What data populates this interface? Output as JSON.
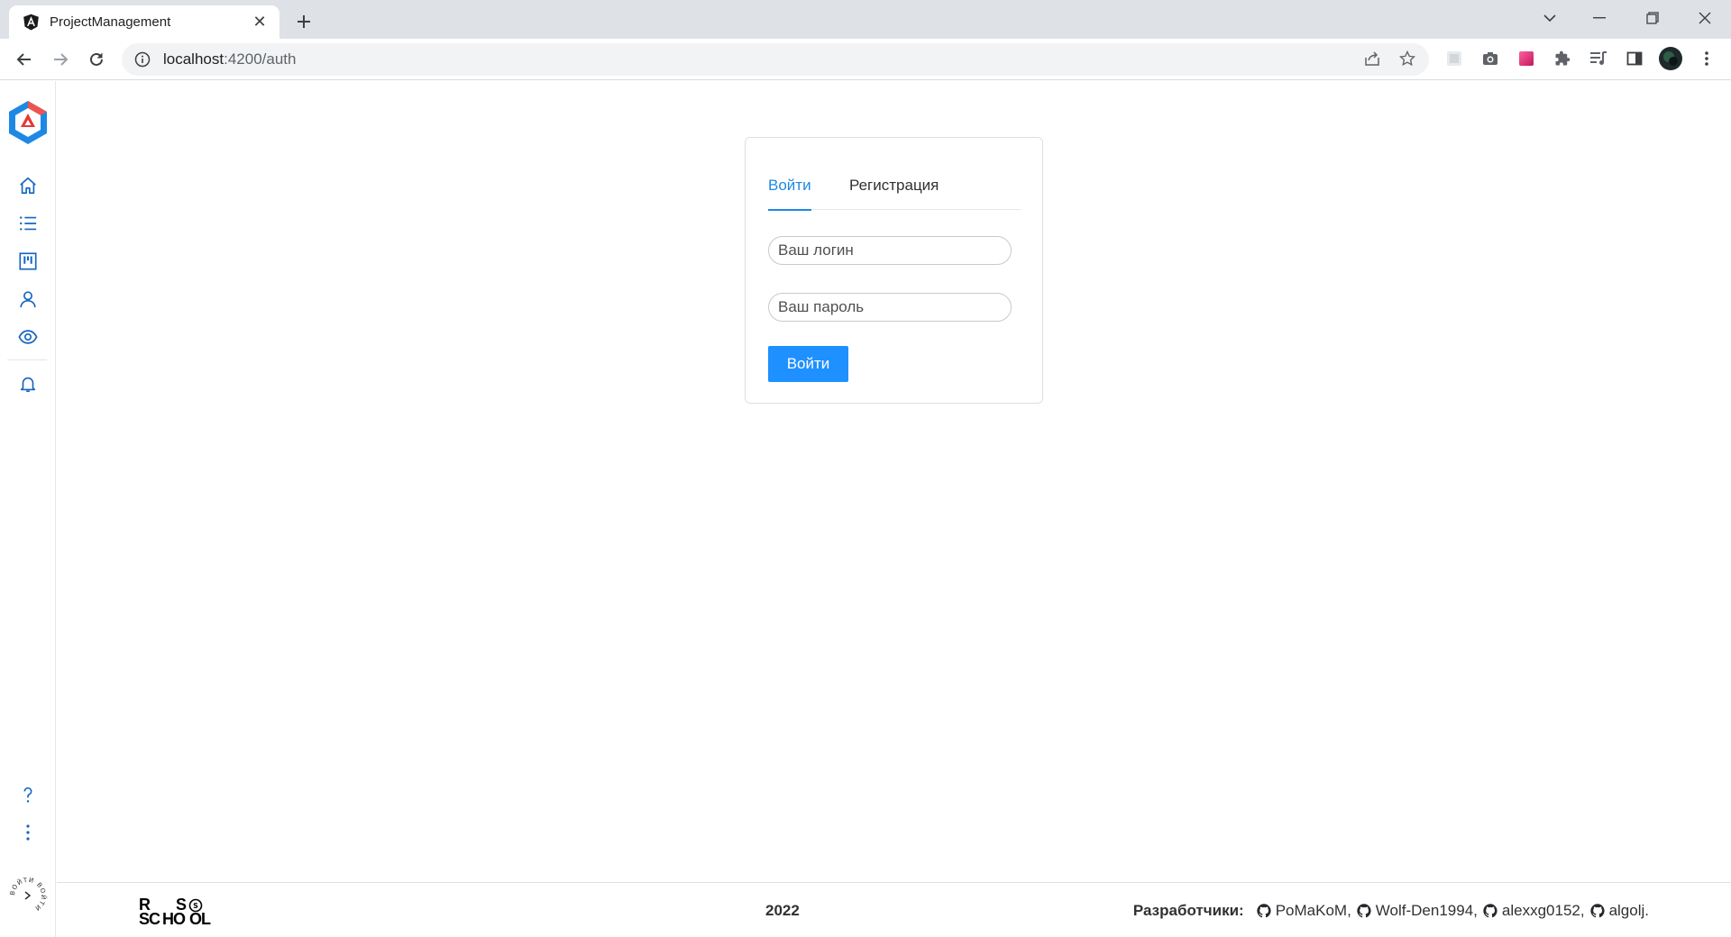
{
  "browser": {
    "tab_title": "ProjectManagement",
    "tab_close": "✕",
    "url_host": "localhost",
    "url_rest": ":4200/auth"
  },
  "sidebar": {
    "items": [
      "home-icon",
      "list-icon",
      "board-icon",
      "user-icon",
      "eye-icon",
      "bell-icon"
    ],
    "bottom_items": [
      "help-icon",
      "more-icon"
    ],
    "badge_text": "ВОЙТИ ВОЙТИ"
  },
  "auth": {
    "tabs": [
      {
        "label": "Войти",
        "active": true
      },
      {
        "label": "Регистрация",
        "active": false
      }
    ],
    "login_placeholder": "Ваш логин",
    "password_placeholder": "Ваш пароль",
    "submit_label": "Войти"
  },
  "footer": {
    "logo_letters": [
      "R",
      "S",
      "SC",
      "HO",
      "OL",
      "S"
    ],
    "year": "2022",
    "developers_label": "Разработчики:",
    "developers": [
      "PoMaKoM,",
      "Wolf-Den1994,",
      "alexxg0152,",
      "algolj."
    ]
  },
  "colors": {
    "accent": "#1e88e5",
    "button": "#1e90ff",
    "chrome_bg": "#dee1e6",
    "sidebar_icon": "#1565c0"
  }
}
